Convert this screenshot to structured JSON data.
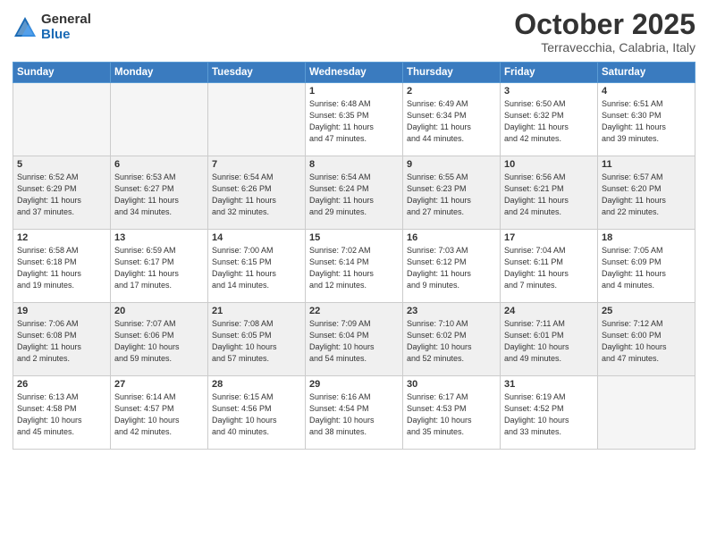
{
  "header": {
    "logo_general": "General",
    "logo_blue": "Blue",
    "month": "October 2025",
    "location": "Terravecchia, Calabria, Italy"
  },
  "weekdays": [
    "Sunday",
    "Monday",
    "Tuesday",
    "Wednesday",
    "Thursday",
    "Friday",
    "Saturday"
  ],
  "weeks": [
    {
      "shade": false,
      "days": [
        {
          "num": "",
          "info": ""
        },
        {
          "num": "",
          "info": ""
        },
        {
          "num": "",
          "info": ""
        },
        {
          "num": "1",
          "info": "Sunrise: 6:48 AM\nSunset: 6:35 PM\nDaylight: 11 hours\nand 47 minutes."
        },
        {
          "num": "2",
          "info": "Sunrise: 6:49 AM\nSunset: 6:34 PM\nDaylight: 11 hours\nand 44 minutes."
        },
        {
          "num": "3",
          "info": "Sunrise: 6:50 AM\nSunset: 6:32 PM\nDaylight: 11 hours\nand 42 minutes."
        },
        {
          "num": "4",
          "info": "Sunrise: 6:51 AM\nSunset: 6:30 PM\nDaylight: 11 hours\nand 39 minutes."
        }
      ]
    },
    {
      "shade": true,
      "days": [
        {
          "num": "5",
          "info": "Sunrise: 6:52 AM\nSunset: 6:29 PM\nDaylight: 11 hours\nand 37 minutes."
        },
        {
          "num": "6",
          "info": "Sunrise: 6:53 AM\nSunset: 6:27 PM\nDaylight: 11 hours\nand 34 minutes."
        },
        {
          "num": "7",
          "info": "Sunrise: 6:54 AM\nSunset: 6:26 PM\nDaylight: 11 hours\nand 32 minutes."
        },
        {
          "num": "8",
          "info": "Sunrise: 6:54 AM\nSunset: 6:24 PM\nDaylight: 11 hours\nand 29 minutes."
        },
        {
          "num": "9",
          "info": "Sunrise: 6:55 AM\nSunset: 6:23 PM\nDaylight: 11 hours\nand 27 minutes."
        },
        {
          "num": "10",
          "info": "Sunrise: 6:56 AM\nSunset: 6:21 PM\nDaylight: 11 hours\nand 24 minutes."
        },
        {
          "num": "11",
          "info": "Sunrise: 6:57 AM\nSunset: 6:20 PM\nDaylight: 11 hours\nand 22 minutes."
        }
      ]
    },
    {
      "shade": false,
      "days": [
        {
          "num": "12",
          "info": "Sunrise: 6:58 AM\nSunset: 6:18 PM\nDaylight: 11 hours\nand 19 minutes."
        },
        {
          "num": "13",
          "info": "Sunrise: 6:59 AM\nSunset: 6:17 PM\nDaylight: 11 hours\nand 17 minutes."
        },
        {
          "num": "14",
          "info": "Sunrise: 7:00 AM\nSunset: 6:15 PM\nDaylight: 11 hours\nand 14 minutes."
        },
        {
          "num": "15",
          "info": "Sunrise: 7:02 AM\nSunset: 6:14 PM\nDaylight: 11 hours\nand 12 minutes."
        },
        {
          "num": "16",
          "info": "Sunrise: 7:03 AM\nSunset: 6:12 PM\nDaylight: 11 hours\nand 9 minutes."
        },
        {
          "num": "17",
          "info": "Sunrise: 7:04 AM\nSunset: 6:11 PM\nDaylight: 11 hours\nand 7 minutes."
        },
        {
          "num": "18",
          "info": "Sunrise: 7:05 AM\nSunset: 6:09 PM\nDaylight: 11 hours\nand 4 minutes."
        }
      ]
    },
    {
      "shade": true,
      "days": [
        {
          "num": "19",
          "info": "Sunrise: 7:06 AM\nSunset: 6:08 PM\nDaylight: 11 hours\nand 2 minutes."
        },
        {
          "num": "20",
          "info": "Sunrise: 7:07 AM\nSunset: 6:06 PM\nDaylight: 10 hours\nand 59 minutes."
        },
        {
          "num": "21",
          "info": "Sunrise: 7:08 AM\nSunset: 6:05 PM\nDaylight: 10 hours\nand 57 minutes."
        },
        {
          "num": "22",
          "info": "Sunrise: 7:09 AM\nSunset: 6:04 PM\nDaylight: 10 hours\nand 54 minutes."
        },
        {
          "num": "23",
          "info": "Sunrise: 7:10 AM\nSunset: 6:02 PM\nDaylight: 10 hours\nand 52 minutes."
        },
        {
          "num": "24",
          "info": "Sunrise: 7:11 AM\nSunset: 6:01 PM\nDaylight: 10 hours\nand 49 minutes."
        },
        {
          "num": "25",
          "info": "Sunrise: 7:12 AM\nSunset: 6:00 PM\nDaylight: 10 hours\nand 47 minutes."
        }
      ]
    },
    {
      "shade": false,
      "days": [
        {
          "num": "26",
          "info": "Sunrise: 6:13 AM\nSunset: 4:58 PM\nDaylight: 10 hours\nand 45 minutes."
        },
        {
          "num": "27",
          "info": "Sunrise: 6:14 AM\nSunset: 4:57 PM\nDaylight: 10 hours\nand 42 minutes."
        },
        {
          "num": "28",
          "info": "Sunrise: 6:15 AM\nSunset: 4:56 PM\nDaylight: 10 hours\nand 40 minutes."
        },
        {
          "num": "29",
          "info": "Sunrise: 6:16 AM\nSunset: 4:54 PM\nDaylight: 10 hours\nand 38 minutes."
        },
        {
          "num": "30",
          "info": "Sunrise: 6:17 AM\nSunset: 4:53 PM\nDaylight: 10 hours\nand 35 minutes."
        },
        {
          "num": "31",
          "info": "Sunrise: 6:19 AM\nSunset: 4:52 PM\nDaylight: 10 hours\nand 33 minutes."
        },
        {
          "num": "",
          "info": ""
        }
      ]
    }
  ]
}
